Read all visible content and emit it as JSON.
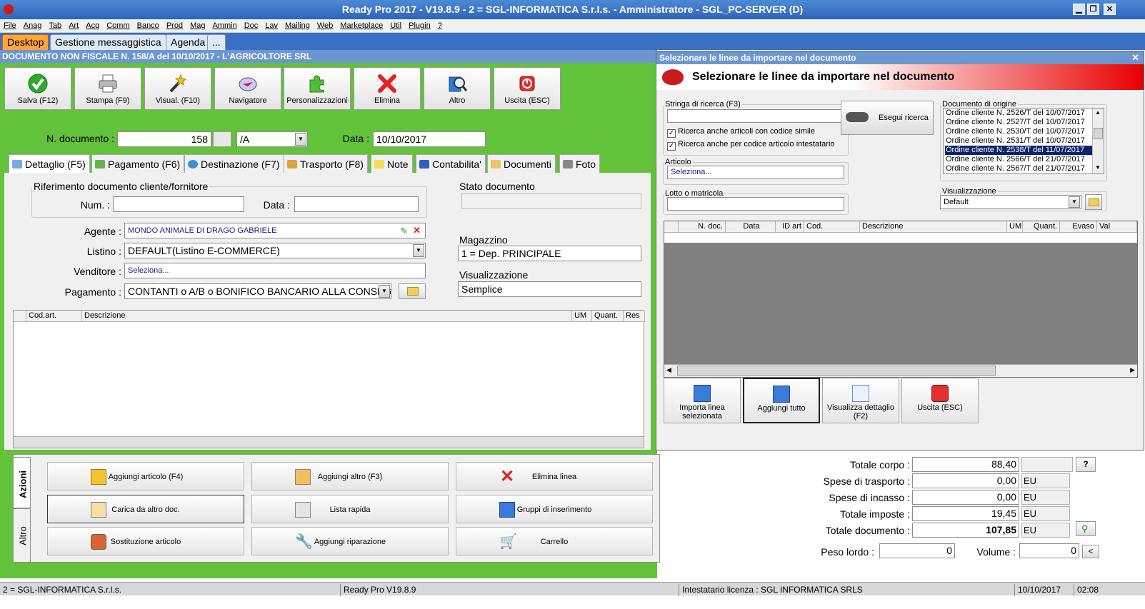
{
  "window": {
    "title": "Ready Pro 2017 - V19.8.9 - 2 = SGL-INFORMATICA S.r.l.s. - Amministratore - SGL_PC-SERVER (D)",
    "minimize": "▁",
    "maximize": "❐",
    "close": "✕"
  },
  "menu": [
    "File",
    "Anag",
    "Tab",
    "Art",
    "Acq",
    "Comm",
    "Banco",
    "Prod",
    "Mag",
    "Ammin",
    "Doc",
    "Lav",
    "Mailing",
    "Web",
    "Marketplace",
    "Util",
    "Plugin",
    "?"
  ],
  "app_tabs": [
    "Desktop",
    "Gestione messaggistica",
    "Agenda",
    "..."
  ],
  "document": {
    "title": "DOCUMENTO NON FISCALE N. 158/A del 10/10/2017 - L'AGRICOLTORE SRL",
    "toolbar": [
      {
        "label": "Salva (F12)",
        "icon": "check-icon"
      },
      {
        "label": "Stampa (F9)",
        "icon": "printer-icon"
      },
      {
        "label": "Visual. (F10)",
        "icon": "magic-wand-icon"
      },
      {
        "label": "Navigatore",
        "icon": "compass-icon"
      },
      {
        "label": "Personalizzazioni",
        "icon": "puzzle-icon"
      },
      {
        "label": "Elimina",
        "icon": "delete-x-icon"
      },
      {
        "label": "Altro",
        "icon": "magnifier-book-icon"
      },
      {
        "label": "Uscita (ESC)",
        "icon": "exit-icon"
      }
    ],
    "num_label": "N. documento :",
    "num_value": "158",
    "suffix_value": "/A",
    "date_label": "Data :",
    "date_value": "10/10/2017",
    "tabs": [
      "Dettaglio (F5)",
      "Pagamento (F6)",
      "Destinazione (F7)",
      "Trasporto (F8)",
      "Note",
      "Contabilita'",
      "Documenti",
      "Foto"
    ],
    "riferimento": {
      "legend": "Riferimento documento cliente/fornitore",
      "num_label": "Num. :",
      "num_value": "",
      "data_label": "Data :",
      "data_value": ""
    },
    "agente_label": "Agente :",
    "agente_value": "MONDO ANIMALE DI DRAGO GABRIELE",
    "listino_label": "Listino :",
    "listino_value": "DEFAULT(Listino E-COMMERCE)",
    "venditore_label": "Venditore :",
    "venditore_value": "Seleziona...",
    "pagamento_label": "Pagamento :",
    "pagamento_value": "CONTANTI o A/B o BONIFICO BANCARIO ALLA CONSEGNA",
    "stato_label": "Stato documento",
    "stato_value": "",
    "magazzino_label": "Magazzino",
    "magazzino_value": "1 = Dep. PRINCIPALE",
    "visualizzazione_label": "Visualizzazione",
    "visualizzazione_value": "Semplice",
    "grid_columns": [
      "Cod.art.",
      "Descrizione",
      "UM",
      "Quant.",
      "Res"
    ],
    "side_tabs": [
      "Azioni",
      "Altro"
    ],
    "actions": [
      {
        "label": "Aggiungi articolo (F4)",
        "icon": "add-article-icon"
      },
      {
        "label": "Aggiungi altro (F3)",
        "icon": "add-other-icon"
      },
      {
        "label": "Elimina linea",
        "icon": "delete-line-icon"
      },
      {
        "label": "Carica da altro doc.",
        "icon": "load-document-icon"
      },
      {
        "label": "Lista rapida",
        "icon": "quick-list-icon"
      },
      {
        "label": "Gruppi di inserimento",
        "icon": "insert-group-icon"
      },
      {
        "label": "Sostituzione articolo",
        "icon": "replace-article-icon"
      },
      {
        "label": "Aggiungi riparazione",
        "icon": "wrench-icon"
      },
      {
        "label": "Carrello",
        "icon": "cart-icon"
      }
    ],
    "totals": [
      {
        "label": "Totale corpo :",
        "value": "88,40",
        "unit": ""
      },
      {
        "label": "Spese di trasporto :",
        "value": "0,00",
        "unit": "EU"
      },
      {
        "label": "Spese di incasso :",
        "value": "0,00",
        "unit": "EU"
      },
      {
        "label": "Totale imposte :",
        "value": "19,45",
        "unit": "EU"
      },
      {
        "label": "Totale documento :",
        "value": "107,85",
        "unit": "EU"
      }
    ],
    "help_button": "?",
    "peso_label": "Peso lordo :",
    "peso_value": "0",
    "volume_label": "Volume :",
    "volume_value": "0",
    "volume_btn": "<"
  },
  "dialog": {
    "title": "Selezionare le linee da importare nel documento",
    "banner": "Selezionare le linee da importare nel documento",
    "search_legend": "Stringa di ricerca (F3)",
    "search_value": "",
    "check_similar": "Ricerca anche articoli con codice simile",
    "check_owner": "Ricerca anche per codice articolo intestatario",
    "search_button": "Esegui ricerca",
    "articolo_legend": "Articolo",
    "articolo_value": "Seleziona...",
    "lotto_legend": "Lotto o matricola",
    "lotto_value": "",
    "origin_legend": "Documento di origine",
    "origin_items": [
      "Ordine cliente N. 2526/T del 10/07/2017",
      "Ordine cliente N. 2527/T del 10/07/2017",
      "Ordine cliente N. 2530/T del 10/07/2017",
      "Ordine cliente N. 2531/T del 10/07/2017",
      "Ordine cliente N. 2538/T del 11/07/2017",
      "Ordine cliente N. 2566/T del 21/07/2017",
      "Ordine cliente N. 2567/T del 21/07/2017"
    ],
    "selected_index": 4,
    "vis_legend": "Visualizzazione",
    "vis_value": "Default",
    "grid_columns": [
      "N. doc.",
      "Data",
      "ID art",
      "Cod.",
      "Descrizione",
      "UM",
      "Quant.",
      "Evaso",
      "Val"
    ],
    "buttons": [
      {
        "label": "Importa linea selezionata",
        "icon": "import-line-icon"
      },
      {
        "label": "Aggiungi tutto",
        "icon": "add-all-icon"
      },
      {
        "label": "Visualizza dettaglio (F2)",
        "icon": "view-detail-icon"
      },
      {
        "label": "Uscita (ESC)",
        "icon": "exit-icon"
      }
    ]
  },
  "status": {
    "company": "2 = SGL-INFORMATICA S.r.l.s.",
    "version": "Ready Pro V19.8.9",
    "license": "Intestatario licenza : SGL INFORMATICA SRLS",
    "date": "10/10/2017",
    "time": "02:08"
  },
  "colors": {
    "app_green": "#62c23a",
    "title_blue": "#6c96cf",
    "accent_red": "#e80000",
    "selection": "#0a246a"
  }
}
